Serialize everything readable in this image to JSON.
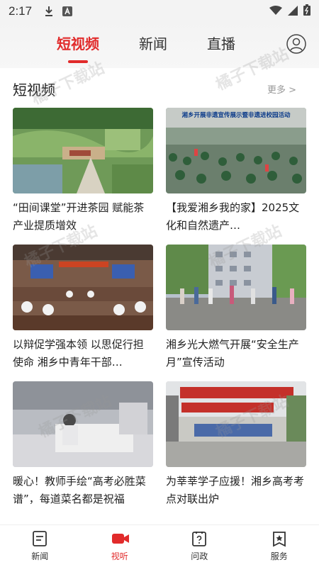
{
  "status": {
    "time": "2:17"
  },
  "header": {
    "tabs": [
      {
        "label": "短视频",
        "active": true
      },
      {
        "label": "新闻",
        "active": false
      },
      {
        "label": "直播",
        "active": false
      }
    ]
  },
  "section": {
    "title": "短视频",
    "more": "更多 >"
  },
  "cards": [
    {
      "title": "“田间课堂”开进茶园 赋能茶产业提质增效"
    },
    {
      "title": "【我爱湘乡我的家】2025文化和自然遗产…",
      "banner": "湘乡开展非遗宣传展示暨非遗进校园活动"
    },
    {
      "title": "以辩促学强本领 以思促行担使命 湘乡中青年干部…"
    },
    {
      "title": "湘乡光大燃气开展“安全生产月”宣传活动"
    },
    {
      "title": "暖心！教师手绘“高考必胜菜谱”，每道菜名都是祝福"
    },
    {
      "title": "为莘莘学子应援！湘乡高考考点对联出炉"
    }
  ],
  "bottomnav": [
    {
      "label": "新闻",
      "icon": "news-icon",
      "active": false
    },
    {
      "label": "视听",
      "icon": "video-icon",
      "active": true
    },
    {
      "label": "问政",
      "icon": "question-icon",
      "active": false
    },
    {
      "label": "服务",
      "icon": "service-icon",
      "active": false
    }
  ],
  "watermark": "橘子下载站",
  "colors": {
    "accent": "#e12b2b"
  }
}
